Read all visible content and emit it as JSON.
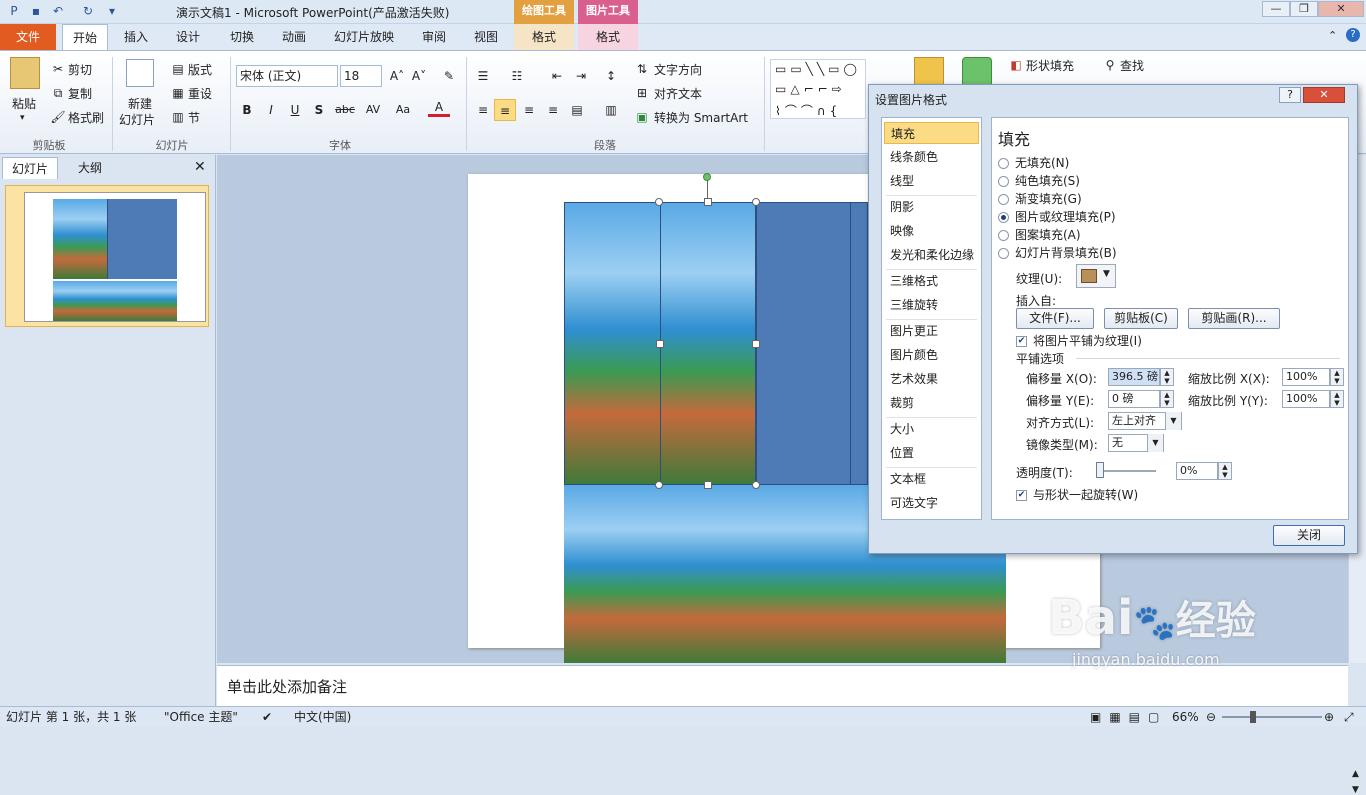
{
  "window": {
    "title": "演示文稿1 - Microsoft PowerPoint(产品激活失败)"
  },
  "context_tabs": {
    "drawing": "绘图工具",
    "picture": "图片工具"
  },
  "tabs": {
    "file": "文件",
    "home": "开始",
    "insert": "插入",
    "design": "设计",
    "transitions": "切换",
    "animations": "动画",
    "slideshow": "幻灯片放映",
    "review": "审阅",
    "view": "视图",
    "format1": "格式",
    "format2": "格式"
  },
  "ribbon": {
    "clipboard": {
      "paste": "粘贴",
      "cut": "剪切",
      "copy": "复制",
      "painter": "格式刷",
      "label": "剪贴板"
    },
    "slides": {
      "new": "新建",
      "new2": "幻灯片",
      "layout": "版式",
      "reset": "重设",
      "section": "节",
      "label": "幻灯片"
    },
    "font": {
      "name": "宋体 (正文)",
      "size": "18",
      "label": "字体",
      "bold": "B",
      "italic": "I",
      "underline": "U",
      "shadow": "S",
      "strike": "abc",
      "spacing": "AV",
      "case": "Aa",
      "color": "A"
    },
    "paragraph": {
      "direction": "文字方向",
      "align": "对齐文本",
      "smartart": "转换为 SmartArt",
      "label": "段落"
    },
    "drawing": {
      "shapefill": "形状填充",
      "find": "查找"
    }
  },
  "left_pane": {
    "tab_slides": "幻灯片",
    "tab_outline": "大纲",
    "slide_number": "1"
  },
  "notes": {
    "placeholder": "单击此处添加备注"
  },
  "status": {
    "slide_info": "幻灯片 第 1 张，共 1 张",
    "theme": "\"Office 主题\"",
    "language": "中文(中国)",
    "zoom": "66%"
  },
  "dialog": {
    "title": "设置图片格式",
    "help": "?",
    "nav": [
      "填充",
      "线条颜色",
      "线型",
      "阴影",
      "映像",
      "发光和柔化边缘",
      "三维格式",
      "三维旋转",
      "图片更正",
      "图片颜色",
      "艺术效果",
      "裁剪",
      "大小",
      "位置",
      "文本框",
      "可选文字"
    ],
    "selected_nav": "填充",
    "heading": "填充",
    "options": [
      "无填充(N)",
      "纯色填充(S)",
      "渐变填充(G)",
      "图片或纹理填充(P)",
      "图案填充(A)",
      "幻灯片背景填充(B)"
    ],
    "selected_option": 3,
    "texture_label": "纹理(U):",
    "insert_from": "插入自:",
    "btn_file": "文件(F)...",
    "btn_clipboard": "剪贴板(C)",
    "btn_clipart": "剪贴画(R)...",
    "tile_checkbox": "将图片平铺为纹理(I)",
    "tile_section": "平铺选项",
    "offset_x_label": "偏移量 X(O):",
    "offset_x": "396.5 磅",
    "offset_y_label": "偏移量 Y(E):",
    "offset_y": "0 磅",
    "scale_x_label": "缩放比例 X(X):",
    "scale_x": "100%",
    "scale_y_label": "缩放比例 Y(Y):",
    "scale_y": "100%",
    "align_label": "对齐方式(L):",
    "align_value": "左上对齐",
    "mirror_label": "镜像类型(M):",
    "mirror_value": "无",
    "transparency_label": "透明度(T):",
    "transparency_value": "0%",
    "transparency_level": 0,
    "rotate_checkbox": "与形状一起旋转(W)",
    "close": "关闭"
  },
  "watermark": {
    "brand": "Bai",
    "brand2": "经验",
    "url": "jingyan.baidu.com"
  }
}
